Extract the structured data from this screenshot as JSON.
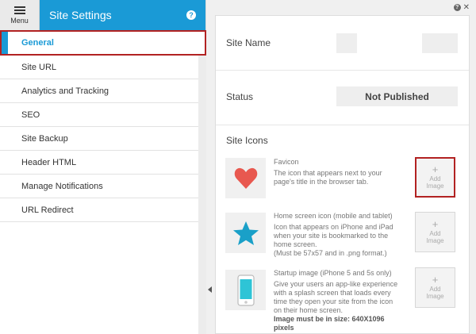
{
  "header": {
    "menu_label": "Menu",
    "title": "Site Settings",
    "help_glyph": "?"
  },
  "nav": [
    {
      "label": "General",
      "active": true
    },
    {
      "label": "Site URL"
    },
    {
      "label": "Analytics and Tracking"
    },
    {
      "label": "SEO"
    },
    {
      "label": "Site Backup"
    },
    {
      "label": "Header HTML"
    },
    {
      "label": "Manage Notifications"
    },
    {
      "label": "URL Redirect"
    }
  ],
  "panel": {
    "help_glyph": "?",
    "close_glyph": "✕",
    "site_name_label": "Site Name",
    "status_label": "Status",
    "status_value": "Not Published",
    "site_icons_label": "Site Icons",
    "add_plus": "+",
    "add_label_1": "Add",
    "add_label_2": "Image",
    "favicon": {
      "title": "Favicon",
      "desc": "The icon that appears next to your page's title in the browser tab."
    },
    "home_icon": {
      "title": "Home screen icon (mobile and tablet)",
      "desc": "Icon that appears on iPhone and iPad when your site is bookmarked to the home screen.",
      "note": "(Must be 57x57 and in .png format.)"
    },
    "startup": {
      "title": "Startup image (iPhone 5 and 5s only)",
      "desc": "Give your users an app-like experience with a splash screen that loads every time they open your site from the icon on their home screen.",
      "bold": "Image must be in size: 640X1096 pixels"
    }
  },
  "colors": {
    "accent": "#1a9ad6",
    "highlight": "#b22222",
    "heart": "#e8584f",
    "star": "#1aa0c8"
  }
}
